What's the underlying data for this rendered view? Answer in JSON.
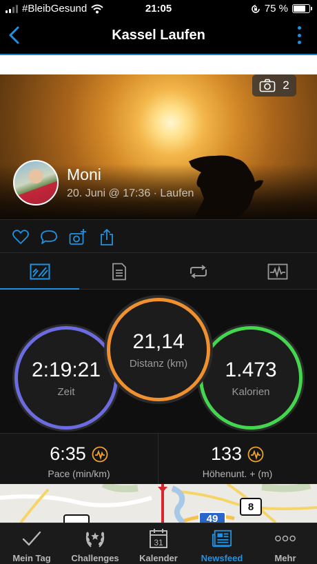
{
  "status_bar": {
    "carrier": "#BleibGesund",
    "time": "21:05",
    "battery": "75 %",
    "battery_level": 0.75
  },
  "nav": {
    "title": "Kassel Laufen"
  },
  "hero": {
    "photo_count": "2",
    "user_name": "Moni",
    "subtitle": "20. Juni @ 17:36 · Laufen"
  },
  "stats": {
    "time": {
      "value": "2:19:21",
      "label": "Zeit"
    },
    "distance": {
      "value": "21,14",
      "label": "Distanz (km)"
    },
    "calories": {
      "value": "1.473",
      "label": "Kalorien"
    }
  },
  "metrics": {
    "pace": {
      "value": "6:35",
      "label": "Pace (min/km)"
    },
    "elevation": {
      "value": "133",
      "label": "Höhenunt. + (m)"
    }
  },
  "map": {
    "road_badge": "8",
    "highway_badge": "49"
  },
  "bottom_bar": {
    "items": [
      {
        "label": "Mein Tag",
        "icon": "checkmark-icon"
      },
      {
        "label": "Challenges",
        "icon": "laurel-icon"
      },
      {
        "label": "Kalender",
        "icon": "calendar-icon",
        "day": "31"
      },
      {
        "label": "Newsfeed",
        "icon": "newsfeed-icon"
      },
      {
        "label": "Mehr",
        "icon": "more-dots-icon"
      }
    ]
  },
  "colors": {
    "accent": "#1f93e3",
    "time_ring": "#6d6be0",
    "distance_ring": "#f0902e",
    "calories_ring": "#43d64e",
    "badge_orange": "#f0a22e"
  }
}
